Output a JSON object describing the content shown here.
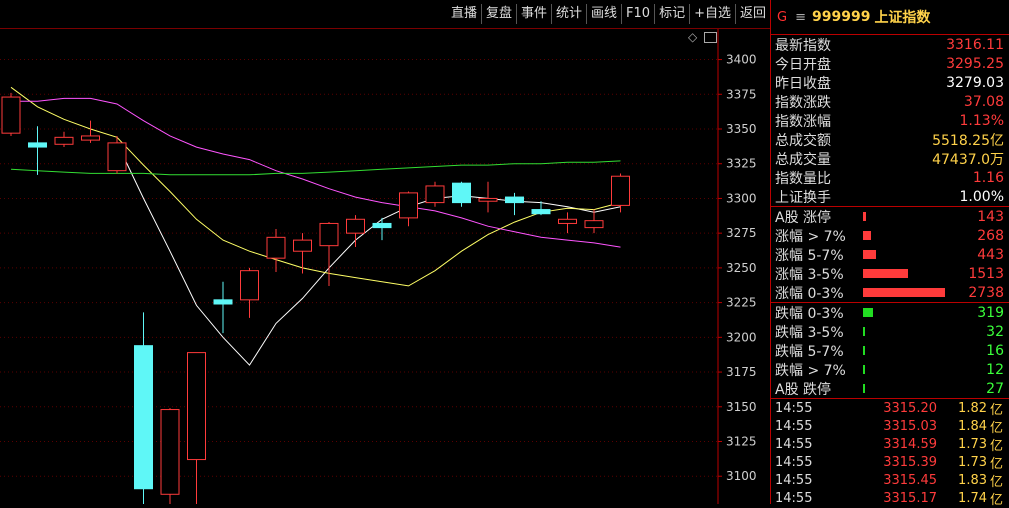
{
  "toolbar": {
    "buttons": [
      "直播",
      "复盘",
      "事件",
      "统计",
      "画线",
      "F10",
      "标记",
      "+自选",
      "返回"
    ]
  },
  "chart_data": {
    "type": "candlestick",
    "y_ticks": [
      3100,
      3125,
      3150,
      3175,
      3200,
      3225,
      3250,
      3275,
      3300,
      3325,
      3350,
      3375,
      3400
    ],
    "ylim": [
      3080,
      3422
    ],
    "candles": [
      {
        "o": 3347,
        "h": 3376,
        "l": 3345,
        "c": 3373
      },
      {
        "o": 3340,
        "h": 3352,
        "l": 3317,
        "c": 3337
      },
      {
        "o": 3339,
        "h": 3348,
        "l": 3337,
        "c": 3344
      },
      {
        "o": 3342,
        "h": 3356,
        "l": 3340,
        "c": 3345
      },
      {
        "o": 3320,
        "h": 3345,
        "l": 3318,
        "c": 3340
      },
      {
        "o": 3194,
        "h": 3218,
        "l": 3071,
        "c": 3091
      },
      {
        "o": 3087,
        "h": 3149,
        "l": 3077,
        "c": 3148
      },
      {
        "o": 3112,
        "h": 3189,
        "l": 3070,
        "c": 3189
      },
      {
        "o": 3227,
        "h": 3240,
        "l": 3203,
        "c": 3224
      },
      {
        "o": 3227,
        "h": 3250,
        "l": 3214,
        "c": 3248
      },
      {
        "o": 3257,
        "h": 3278,
        "l": 3247,
        "c": 3272
      },
      {
        "o": 3262,
        "h": 3275,
        "l": 3246,
        "c": 3270
      },
      {
        "o": 3266,
        "h": 3283,
        "l": 3237,
        "c": 3282
      },
      {
        "o": 3275,
        "h": 3288,
        "l": 3265,
        "c": 3285
      },
      {
        "o": 3282,
        "h": 3286,
        "l": 3270,
        "c": 3279
      },
      {
        "o": 3286,
        "h": 3305,
        "l": 3280,
        "c": 3304
      },
      {
        "o": 3297,
        "h": 3312,
        "l": 3294,
        "c": 3309
      },
      {
        "o": 3311,
        "h": 3312,
        "l": 3294,
        "c": 3297
      },
      {
        "o": 3298,
        "h": 3312,
        "l": 3290,
        "c": 3300
      },
      {
        "o": 3301,
        "h": 3304,
        "l": 3288,
        "c": 3297
      },
      {
        "o": 3292,
        "h": 3298,
        "l": 3288,
        "c": 3289
      },
      {
        "o": 3282,
        "h": 3290,
        "l": 3275,
        "c": 3285
      },
      {
        "o": 3279,
        "h": 3292,
        "l": 3275,
        "c": 3284
      },
      {
        "o": 3295,
        "h": 3318,
        "l": 3290,
        "c": 3316
      }
    ],
    "series": [
      {
        "color": "#ffffff",
        "values": [
          null,
          null,
          null,
          null,
          3340,
          3300,
          3262,
          3223,
          3200,
          3180,
          3210,
          3228,
          3250,
          3270,
          3285,
          3294,
          3300,
          3302,
          3300,
          3298,
          3297,
          3294,
          3290,
          3294
        ]
      },
      {
        "color": "#ffff66",
        "values": [
          3380,
          3366,
          3357,
          3350,
          3344,
          3324,
          3305,
          3285,
          3270,
          3262,
          3256,
          3250,
          3246,
          3243,
          3240,
          3237,
          3248,
          3262,
          3274,
          3283,
          3290,
          3293,
          3292,
          3297
        ]
      },
      {
        "color": "#ff55ff",
        "values": [
          3370,
          3370,
          3372,
          3372,
          3368,
          3356,
          3345,
          3337,
          3332,
          3328,
          3320,
          3314,
          3307,
          3301,
          3297,
          3294,
          3291,
          3286,
          3280,
          3276,
          3272,
          3270,
          3268,
          3265
        ]
      },
      {
        "color": "#33dd33",
        "values": [
          3321,
          3320,
          3319,
          3318,
          3318,
          3318,
          3317,
          3317,
          3317,
          3317,
          3318,
          3318,
          3319,
          3320,
          3321,
          3322,
          3323,
          3324,
          3324,
          3325,
          3325,
          3326,
          3326,
          3327
        ]
      }
    ]
  },
  "quote": {
    "flag": "G",
    "menu_icon": "≡",
    "code": "999999",
    "name": "上证指数",
    "stats": [
      {
        "label": "最新指数",
        "value": "3316.11",
        "color": "red"
      },
      {
        "label": "今日开盘",
        "value": "3295.25",
        "color": "red"
      },
      {
        "label": "昨日收盘",
        "value": "3279.03",
        "color": "white"
      },
      {
        "label": "指数涨跌",
        "value": "37.08",
        "color": "red"
      },
      {
        "label": "指数涨幅",
        "value": "1.13%",
        "color": "red"
      },
      {
        "label": "总成交额",
        "value": "5518.25亿",
        "color": "yellow"
      },
      {
        "label": "总成交量",
        "value": "47437.0万",
        "color": "yellow"
      },
      {
        "label": "指数量比",
        "value": "1.16",
        "color": "red"
      },
      {
        "label": "上证换手",
        "value": "1.00%",
        "color": "white"
      }
    ],
    "rise": [
      {
        "label": "A股 涨停",
        "value": "143",
        "pct": 2
      },
      {
        "label": "涨幅 > 7%",
        "value": "268",
        "pct": 5
      },
      {
        "label": "涨幅 5-7%",
        "value": "443",
        "pct": 8
      },
      {
        "label": "涨幅 3-5%",
        "value": "1513",
        "pct": 27
      },
      {
        "label": "涨幅 0-3%",
        "value": "2738",
        "pct": 49
      }
    ],
    "fall": [
      {
        "label": "跌幅 0-3%",
        "value": "319",
        "pct": 6
      },
      {
        "label": "跌幅 3-5%",
        "value": "32",
        "pct": 1
      },
      {
        "label": "跌幅 5-7%",
        "value": "16",
        "pct": 0.5
      },
      {
        "label": "跌幅 > 7%",
        "value": "12",
        "pct": 0.5
      },
      {
        "label": "A股 跌停",
        "value": "27",
        "pct": 0.5
      }
    ],
    "ticks": [
      {
        "time": "14:55",
        "price": "3315.20",
        "vol": "1.82",
        "unit": "亿"
      },
      {
        "time": "14:55",
        "price": "3315.03",
        "vol": "1.84",
        "unit": "亿"
      },
      {
        "time": "14:55",
        "price": "3314.59",
        "vol": "1.73",
        "unit": "亿"
      },
      {
        "time": "14:55",
        "price": "3315.39",
        "vol": "1.73",
        "unit": "亿"
      },
      {
        "time": "14:55",
        "price": "3315.45",
        "vol": "1.83",
        "unit": "亿"
      },
      {
        "time": "14:55",
        "price": "3315.17",
        "vol": "1.74",
        "unit": "亿"
      }
    ]
  }
}
